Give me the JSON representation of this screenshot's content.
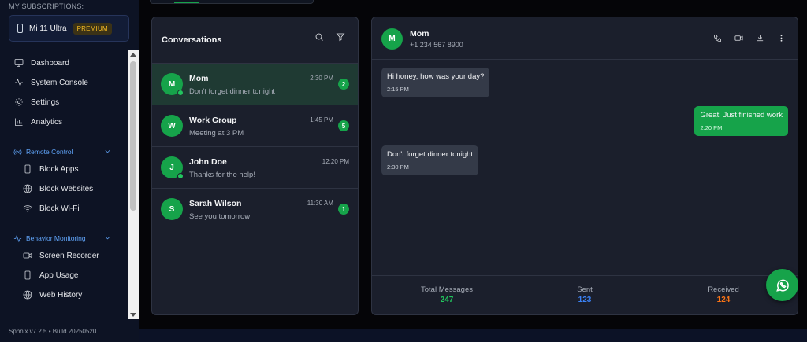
{
  "sidebar": {
    "subscriptions_label": "MY SUBSCRIPTIONS:",
    "device": {
      "name": "Mi 11 Ultra",
      "plan": "PREMIUM"
    },
    "nav": [
      {
        "label": "Dashboard",
        "icon": "monitor-icon"
      },
      {
        "label": "System Console",
        "icon": "activity-icon"
      },
      {
        "label": "Settings",
        "icon": "gear-icon"
      },
      {
        "label": "Analytics",
        "icon": "bar-chart-icon"
      }
    ],
    "remote_control": {
      "label": "Remote Control",
      "items": [
        {
          "label": "Block Apps",
          "icon": "phone-icon"
        },
        {
          "label": "Block Websites",
          "icon": "globe-icon"
        },
        {
          "label": "Block Wi-Fi",
          "icon": "wifi-icon"
        }
      ]
    },
    "behavior_monitoring": {
      "label": "Behavior Monitoring",
      "items": [
        {
          "label": "Screen Recorder",
          "icon": "video-icon"
        },
        {
          "label": "App Usage",
          "icon": "phone-icon"
        },
        {
          "label": "Web History",
          "icon": "globe-icon"
        }
      ]
    },
    "version": "Sphnix v7.2.5 • Build 20250520"
  },
  "conversations": {
    "title": "Conversations",
    "items": [
      {
        "initial": "M",
        "name": "Mom",
        "preview": "Don't forget dinner tonight",
        "time": "2:30 PM",
        "unread": "2",
        "online": true,
        "active": true
      },
      {
        "initial": "W",
        "name": "Work Group",
        "preview": "Meeting at 3 PM",
        "time": "1:45 PM",
        "unread": "5",
        "online": false,
        "active": false
      },
      {
        "initial": "J",
        "name": "John Doe",
        "preview": "Thanks for the help!",
        "time": "12:20 PM",
        "unread": "",
        "online": true,
        "active": false
      },
      {
        "initial": "S",
        "name": "Sarah Wilson",
        "preview": "See you tomorrow",
        "time": "11:30 AM",
        "unread": "1",
        "online": false,
        "active": false
      }
    ]
  },
  "chat": {
    "contact": {
      "initial": "M",
      "name": "Mom",
      "phone": "+1 234 567 8900"
    },
    "messages": [
      {
        "text": "Hi honey, how was your day?",
        "time": "2:15 PM",
        "direction": "in"
      },
      {
        "text": "Great! Just finished work",
        "time": "2:20 PM",
        "direction": "out"
      },
      {
        "text": "Don't forget dinner tonight",
        "time": "2:30 PM",
        "direction": "in"
      }
    ],
    "stats": {
      "total": {
        "label": "Total Messages",
        "value": "247",
        "color": "#22c55e"
      },
      "sent": {
        "label": "Sent",
        "value": "123",
        "color": "#3b82f6"
      },
      "received": {
        "label": "Received",
        "value": "124",
        "color": "#f97316"
      }
    }
  },
  "colors": {
    "accent": "#16a34a",
    "link": "#60a5fa",
    "background": "#050508"
  }
}
